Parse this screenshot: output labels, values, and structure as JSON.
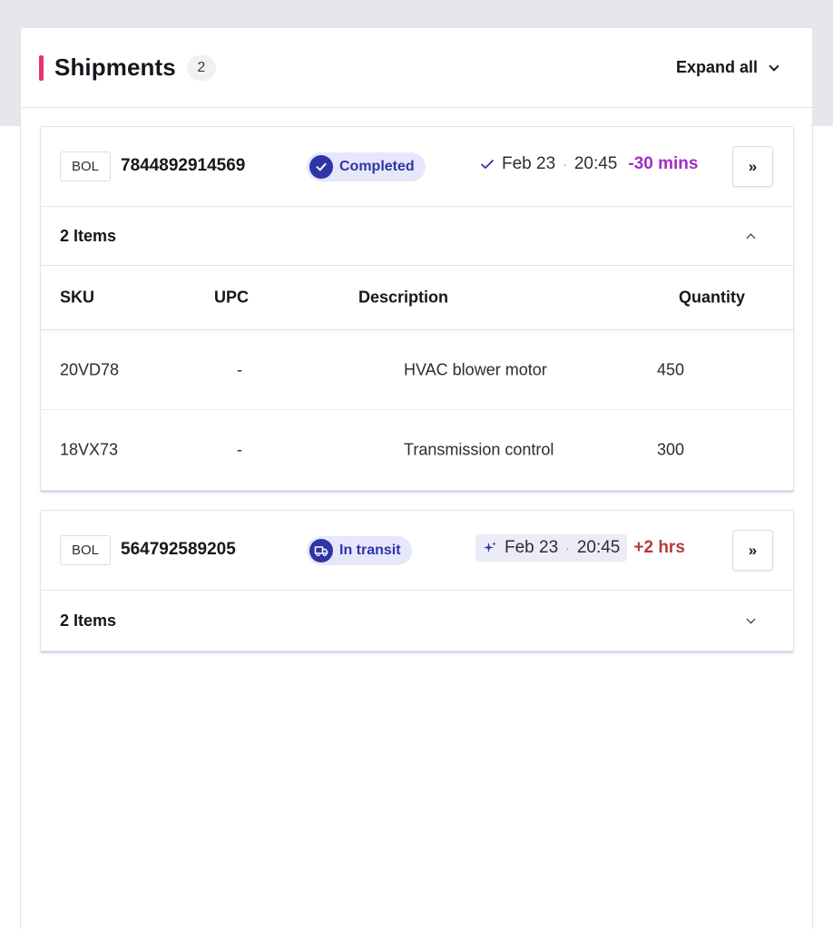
{
  "header": {
    "title": "Shipments",
    "count": "2",
    "expand_all_label": "Expand all"
  },
  "columns": {
    "sku": "SKU",
    "upc": "UPC",
    "description": "Description",
    "quantity": "Quantity"
  },
  "shipments": [
    {
      "bol_label": "BOL",
      "bol_number": "7844892914569",
      "status": "Completed",
      "status_icon": "check-icon",
      "eta_icon": "check-icon",
      "date": "Feb 23",
      "time": "20:45",
      "delta": "-30 mins",
      "delta_color": "#a02ec4",
      "items_label": "2 Items",
      "expanded": true,
      "nav_label": "»",
      "items": [
        {
          "sku": "20VD78",
          "upc": "-",
          "description": "HVAC blower motor",
          "quantity": "450"
        },
        {
          "sku": "18VX73",
          "upc": "-",
          "description": "Transmission control",
          "quantity": "300"
        }
      ]
    },
    {
      "bol_label": "BOL",
      "bol_number": "564792589205",
      "status": "In transit",
      "status_icon": "truck-icon",
      "eta_icon": "sparkle-icon",
      "date": "Feb 23",
      "time": "20:45",
      "delta": "+2 hrs",
      "delta_color": "#b33a3a",
      "items_label": "2 Items",
      "expanded": false,
      "nav_label": "»"
    }
  ],
  "colors": {
    "accent": "#e8336a",
    "status_primary": "#2f35a6",
    "status_bg": "#e6e7fb"
  }
}
